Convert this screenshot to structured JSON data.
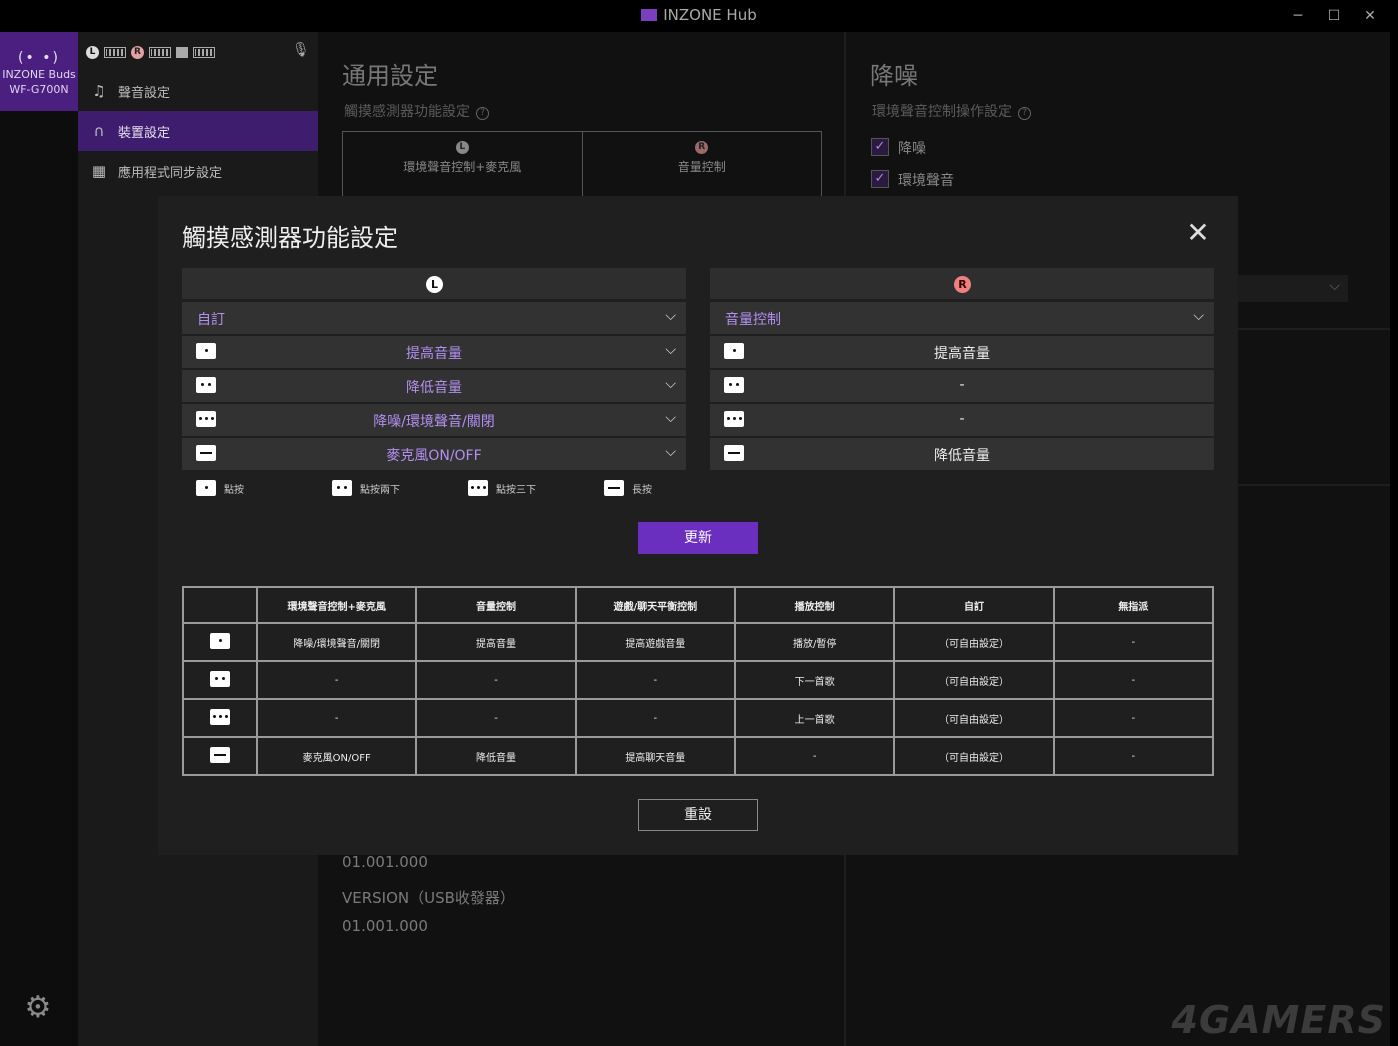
{
  "window": {
    "title": "INZONE Hub",
    "minimize": "─",
    "maximize": "☐",
    "close": "✕"
  },
  "device": {
    "icon_text": "(• •)",
    "name_line1": "INZONE Buds",
    "name_line2": "WF-G700N"
  },
  "status": {
    "left": "L",
    "right": "R"
  },
  "menu": {
    "items": [
      {
        "label": "聲音設定",
        "icon": "♫"
      },
      {
        "label": "裝置設定",
        "icon": "🎧"
      },
      {
        "label": "應用程式同步設定",
        "icon": "▦"
      }
    ]
  },
  "background_main": {
    "heading": "通用設定",
    "subheading": "觸摸感測器功能設定",
    "help": "?",
    "config_left": "環境聲音控制+麥克風",
    "config_right": "音量控制",
    "version_value_1": "01.001.000",
    "version_label_2": "VERSION（USB收發器）",
    "version_value_2": "01.001.000"
  },
  "background_right": {
    "heading": "降噪",
    "subheading": "環境聲音控制操作設定",
    "checkbox_1": "降噪",
    "checkbox_2": "環境聲音",
    "check_mark": "✓",
    "dropdown_chevron": "⌵"
  },
  "modal": {
    "title": "觸摸感測器功能設定",
    "close": "✕",
    "left": {
      "badge": "L",
      "preset": "自訂",
      "actions": [
        "提高音量",
        "降低音量",
        "降噪/環境聲音/關閉",
        "麥克風ON/OFF"
      ]
    },
    "right": {
      "badge": "R",
      "preset": "音量控制",
      "actions": [
        "提高音量",
        "-",
        "-",
        "降低音量"
      ]
    },
    "chevron": "⌵",
    "legend": [
      "點按",
      "點按兩下",
      "點按三下",
      "長按"
    ],
    "update_button": "更新",
    "reset_button": "重設",
    "table": {
      "headers": [
        "",
        "環境聲音控制+麥克風",
        "音量控制",
        "遊戲/聊天平衡控制",
        "播放控制",
        "自訂",
        "無指派"
      ],
      "rows": [
        [
          "降噪/環境聲音/關閉",
          "提高音量",
          "提高遊戲音量",
          "播放/暫停",
          "（可自由設定）",
          "-"
        ],
        [
          "-",
          "-",
          "-",
          "下一首歌",
          "（可自由設定）",
          "-"
        ],
        [
          "-",
          "-",
          "-",
          "上一首歌",
          "（可自由設定）",
          "-"
        ],
        [
          "麥克風ON/OFF",
          "降低音量",
          "提高聊天音量",
          "-",
          "（可自由設定）",
          "-"
        ]
      ]
    }
  },
  "settings_icon": "⚙",
  "watermark": "4GAMERS",
  "colors": {
    "accent": "#6a2fbf",
    "active_menu": "#3f1d6e",
    "device_tile": "#4a1f80",
    "preset_text": "#b38ff0",
    "right_badge": "#f08080"
  }
}
